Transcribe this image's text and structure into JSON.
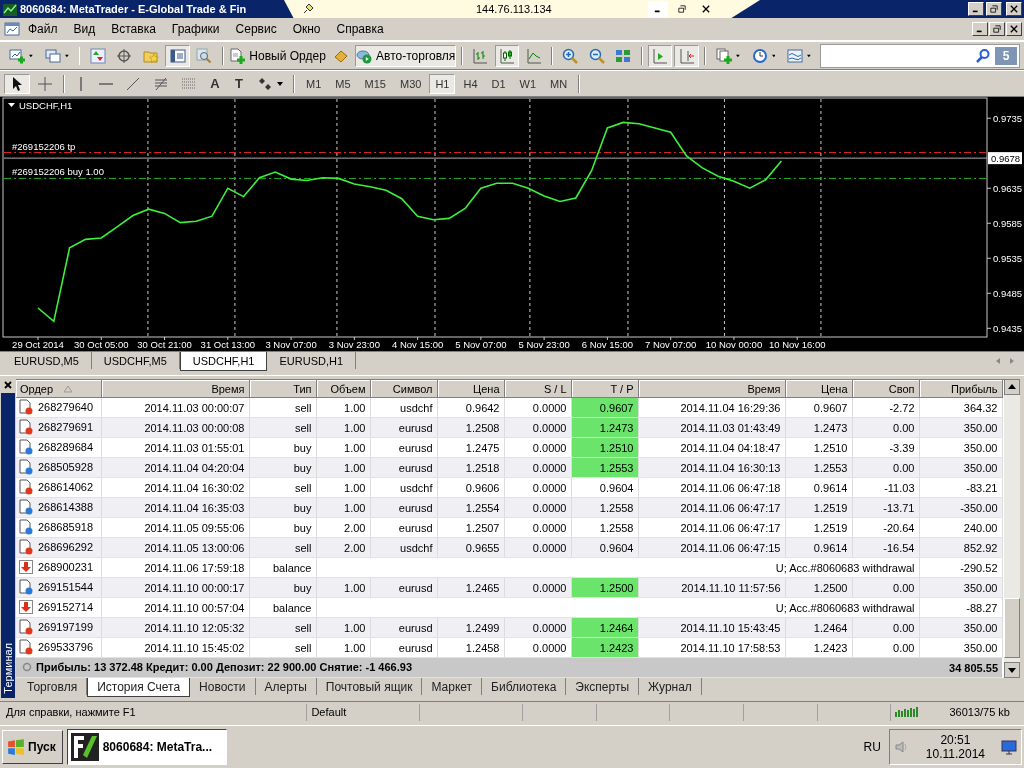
{
  "title_bar": {
    "title": "8060684: MetaTrader - E-Global Trade & Fin"
  },
  "remote_bar": {
    "address": "144.76.113.134"
  },
  "menu": [
    "Файл",
    "Вид",
    "Вставка",
    "Графики",
    "Сервис",
    "Окно",
    "Справка"
  ],
  "toolbar": [
    {
      "kind": "new-chart",
      "pressed": false,
      "dropdown": true
    },
    {
      "kind": "profiles",
      "pressed": false,
      "dropdown": true
    },
    {
      "kind": "separator"
    },
    {
      "kind": "market-watch",
      "pressed": false
    },
    {
      "kind": "navigator",
      "pressed": false
    },
    {
      "kind": "favorites",
      "pressed": false
    },
    {
      "kind": "terminal",
      "pressed": true
    },
    {
      "kind": "tester",
      "pressed": false
    },
    {
      "kind": "separator"
    },
    {
      "kind": "new-order",
      "label": "Новый Ордер",
      "pressed": false
    },
    {
      "kind": "ingot",
      "pressed": false
    },
    {
      "kind": "auto-trading",
      "label": "Авто-торговля",
      "pressed": true
    },
    {
      "kind": "separator"
    },
    {
      "kind": "bars",
      "pressed": false
    },
    {
      "kind": "candles",
      "pressed": true
    },
    {
      "kind": "line",
      "pressed": false
    },
    {
      "kind": "separator"
    },
    {
      "kind": "zoom-in",
      "pressed": false
    },
    {
      "kind": "zoom-out",
      "pressed": false
    },
    {
      "kind": "tile",
      "pressed": false
    },
    {
      "kind": "separator"
    },
    {
      "kind": "shift",
      "pressed": true
    },
    {
      "kind": "autoscroll",
      "pressed": true
    },
    {
      "kind": "separator"
    },
    {
      "kind": "template",
      "pressed": false,
      "dropdown": true
    },
    {
      "kind": "clock",
      "pressed": false,
      "dropdown": true
    },
    {
      "kind": "indicators",
      "pressed": false,
      "dropdown": true
    }
  ],
  "search": {
    "badge": "5"
  },
  "draw_toolbar": [
    {
      "kind": "cursor",
      "pressed": true
    },
    {
      "kind": "cross",
      "pressed": false
    },
    {
      "kind": "separator"
    },
    {
      "kind": "vline",
      "pressed": false
    },
    {
      "kind": "hline",
      "pressed": false
    },
    {
      "kind": "trend",
      "pressed": false
    },
    {
      "kind": "fibo",
      "pressed": false
    },
    {
      "kind": "grid",
      "pressed": false
    },
    {
      "kind": "text-tool",
      "label": "A",
      "pressed": false
    },
    {
      "kind": "label-tool",
      "label": "T",
      "pressed": false
    },
    {
      "kind": "shapes",
      "pressed": false,
      "dropdown": true
    },
    {
      "kind": "separator"
    }
  ],
  "timeframes": [
    {
      "label": "M1",
      "selected": false
    },
    {
      "label": "M5",
      "selected": false
    },
    {
      "label": "M15",
      "selected": false
    },
    {
      "label": "M30",
      "selected": false
    },
    {
      "label": "H1",
      "selected": true
    },
    {
      "label": "H4",
      "selected": false
    },
    {
      "label": "D1",
      "selected": false
    },
    {
      "label": "W1",
      "selected": false
    },
    {
      "label": "MN",
      "selected": false
    }
  ],
  "chart": {
    "chart_data": {
      "type": "line",
      "title": "USDCHF,H1",
      "categories": [
        "29 Oct 2014",
        null,
        null,
        null,
        "30 Oct 05:00",
        null,
        null,
        null,
        "30 Oct 21:00",
        null,
        null,
        null,
        "31 Oct 13:00",
        null,
        null,
        null,
        "3 Nov 07:00",
        null,
        null,
        null,
        "3 Nov 23:00",
        null,
        null,
        null,
        "4 Nov 15:00",
        null,
        null,
        null,
        "5 Nov 07:00",
        null,
        null,
        null,
        "5 Nov 23:00",
        null,
        null,
        null,
        "6 Nov 15:00",
        null,
        null,
        null,
        "7 Nov 07:00",
        null,
        null,
        null,
        "10 Nov 00:00",
        null,
        null,
        null,
        "10 Nov 16:00",
        null,
        null,
        null,
        null,
        null,
        null,
        null,
        null,
        null,
        null,
        null,
        null
      ],
      "series": [
        {
          "color": "#3cf03c",
          "values": [
            0.9464,
            0.9445,
            0.955,
            0.9562,
            0.9564,
            0.958,
            0.9596,
            0.9605,
            0.9599,
            0.9586,
            0.9588,
            0.9595,
            0.9635,
            0.9623,
            0.965,
            0.9658,
            0.9648,
            0.9646,
            0.965,
            0.9649,
            0.9641,
            0.9637,
            0.9632,
            0.962,
            0.9595,
            0.959,
            0.9592,
            0.9606,
            0.9635,
            0.9642,
            0.9642,
            0.9635,
            0.9624,
            0.9616,
            0.9621,
            0.966,
            0.9721,
            0.9729,
            0.9727,
            0.9721,
            0.9715,
            0.9681,
            0.9664,
            0.9652,
            0.9645,
            0.9635,
            0.9647,
            0.9674,
            null,
            null,
            null,
            null,
            null,
            null,
            null,
            null,
            null,
            null,
            null,
            null,
            null
          ]
        }
      ],
      "grid": true,
      "ylim": [
        0.9424,
        0.9761
      ],
      "yticks": [
        0.9735,
        0.9635,
        0.9585,
        0.9535,
        0.9485,
        0.9435
      ],
      "ref_lines": [
        {
          "axis": "y",
          "label": "#269152206 tp",
          "value": 0.9686,
          "color": "#e02020"
        },
        {
          "axis": "y",
          "label": "#269152206 buy 1.00",
          "value": 0.9649,
          "color": "#20b020"
        },
        {
          "axis": "y",
          "value": 0.9678,
          "color": "#b0b0b0"
        }
      ],
      "annotations": [
        {
          "y": 0.9678,
          "text": "0.9678"
        }
      ]
    }
  },
  "chart_tabs": [
    {
      "label": "EURUSD,M5",
      "selected": false
    },
    {
      "label": "USDCHF,M5",
      "selected": false
    },
    {
      "label": "USDCHF,H1",
      "selected": true
    },
    {
      "label": "EURUSD,H1",
      "selected": false
    }
  ],
  "terminal": {
    "title": "Терминал",
    "columns": [
      {
        "label": "Ордер",
        "sorted": true
      },
      {
        "label": "Время",
        "sorted": false
      },
      {
        "label": "Тип",
        "sorted": false
      },
      {
        "label": "Объем",
        "sorted": false
      },
      {
        "label": "Символ",
        "sorted": false
      },
      {
        "label": "Цена",
        "sorted": false
      },
      {
        "label": "S / L",
        "sorted": false
      },
      {
        "label": "T / P",
        "sorted": false
      },
      {
        "label": "Время",
        "sorted": false
      },
      {
        "label": "Цена",
        "sorted": false
      },
      {
        "label": "Своп",
        "sorted": false
      },
      {
        "label": "Прибыль",
        "sorted": false
      }
    ],
    "rows": [
      {
        "kind": "sell",
        "cells": [
          "268279640",
          "2014.11.03 00:00:07",
          "sell",
          "1.00",
          "usdchf",
          "0.9642",
          "0.0000",
          "0.9607",
          "2014.11.04 16:29:36",
          "0.9607",
          "-2.72",
          "364.32"
        ],
        "tp_highlight": true
      },
      {
        "kind": "sell",
        "cells": [
          "268279691",
          "2014.11.03 00:00:08",
          "sell",
          "1.00",
          "eurusd",
          "1.2508",
          "0.0000",
          "1.2473",
          "2014.11.03 01:43:49",
          "1.2473",
          "0.00",
          "350.00"
        ],
        "tp_highlight": true
      },
      {
        "kind": "buy",
        "cells": [
          "268289684",
          "2014.11.03 01:55:01",
          "buy",
          "1.00",
          "eurusd",
          "1.2475",
          "0.0000",
          "1.2510",
          "2014.11.04 04:18:47",
          "1.2510",
          "-3.39",
          "350.00"
        ],
        "tp_highlight": true
      },
      {
        "kind": "buy",
        "cells": [
          "268505928",
          "2014.11.04 04:20:04",
          "buy",
          "1.00",
          "eurusd",
          "1.2518",
          "0.0000",
          "1.2553",
          "2014.11.04 16:30:13",
          "1.2553",
          "0.00",
          "350.00"
        ],
        "tp_highlight": true
      },
      {
        "kind": "sell",
        "cells": [
          "268614062",
          "2014.11.04 16:30:02",
          "sell",
          "1.00",
          "usdchf",
          "0.9606",
          "0.0000",
          "0.9604",
          "2014.11.06 06:47:18",
          "0.9614",
          "-11.03",
          "-83.21"
        ],
        "tp_highlight": false
      },
      {
        "kind": "buy",
        "cells": [
          "268614388",
          "2014.11.04 16:35:03",
          "buy",
          "1.00",
          "eurusd",
          "1.2554",
          "0.0000",
          "1.2558",
          "2014.11.06 06:47:17",
          "1.2519",
          "-13.71",
          "-350.00"
        ],
        "tp_highlight": false
      },
      {
        "kind": "buy",
        "cells": [
          "268685918",
          "2014.11.05 09:55:06",
          "buy",
          "2.00",
          "eurusd",
          "1.2507",
          "0.0000",
          "1.2558",
          "2014.11.06 06:47:17",
          "1.2519",
          "-20.64",
          "240.00"
        ],
        "tp_highlight": false
      },
      {
        "kind": "sell",
        "cells": [
          "268696292",
          "2014.11.05 13:00:06",
          "sell",
          "2.00",
          "usdchf",
          "0.9655",
          "0.0000",
          "0.9604",
          "2014.11.06 06:47:15",
          "0.9614",
          "-16.54",
          "852.92"
        ],
        "tp_highlight": false
      },
      {
        "kind": "balance",
        "cells": [
          "268900231",
          "2014.11.06 17:59:18",
          "balance",
          {
            "text": "U; Acc.#8060683 withdrawal",
            "colspan": 8
          },
          "-290.52"
        ]
      },
      {
        "kind": "buy",
        "cells": [
          "269151544",
          "2014.11.10 00:00:17",
          "buy",
          "1.00",
          "eurusd",
          "1.2465",
          "0.0000",
          "1.2500",
          "2014.11.10 11:57:56",
          "1.2500",
          "0.00",
          "350.00"
        ],
        "tp_highlight": true
      },
      {
        "kind": "balance",
        "cells": [
          "269152714",
          "2014.11.10 00:57:04",
          "balance",
          {
            "text": "U; Acc.#8060683 withdrawal",
            "colspan": 8
          },
          "-88.27"
        ]
      },
      {
        "kind": "sell",
        "cells": [
          "269197199",
          "2014.11.10 12:05:32",
          "sell",
          "1.00",
          "eurusd",
          "1.2499",
          "0.0000",
          "1.2464",
          "2014.11.10 15:43:45",
          "1.2464",
          "0.00",
          "350.00"
        ],
        "tp_highlight": true
      },
      {
        "kind": "sell",
        "cells": [
          "269533796",
          "2014.11.10 15:45:02",
          "sell",
          "1.00",
          "eurusd",
          "1.2458",
          "0.0000",
          "1.2423",
          "2014.11.10 17:58:53",
          "1.2423",
          "0.00",
          "350.00"
        ],
        "tp_highlight": true
      }
    ],
    "summary": {
      "text": "Прибыль: 13 372.48  Кредит: 0.00  Депозит: 22 900.00  Снятие: -1 466.93",
      "total": "34 805.55"
    },
    "tabs": [
      {
        "label": "Торговля",
        "selected": false
      },
      {
        "label": "История Счета",
        "selected": true
      },
      {
        "label": "Новости",
        "selected": false
      },
      {
        "label": "Алерты",
        "selected": false
      },
      {
        "label": "Почтовый ящик",
        "selected": false
      },
      {
        "label": "Маркет",
        "selected": false
      },
      {
        "label": "Библиотека",
        "selected": false
      },
      {
        "label": "Эксперты",
        "selected": false
      },
      {
        "label": "Журнал",
        "selected": false
      }
    ]
  },
  "status_bar": {
    "help": "Для справки, нажмите F1",
    "profile": "Default",
    "traffic": "36013/75 kb"
  },
  "taskbar": {
    "start": "Пуск",
    "tasks": [
      {
        "label": "8060684: MetaTra...",
        "selected": true
      }
    ],
    "language": "RU",
    "time": "20:51",
    "date": "10.11.2014"
  }
}
